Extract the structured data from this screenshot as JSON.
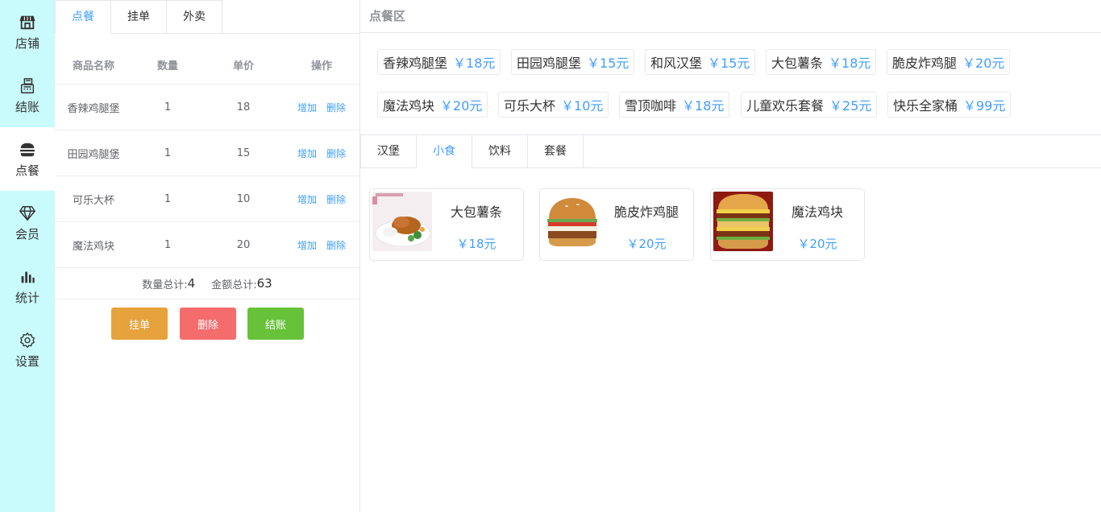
{
  "sidebar": {
    "items": [
      {
        "label": "店铺",
        "icon": "store-icon"
      },
      {
        "label": "结账",
        "icon": "cash-register-icon"
      },
      {
        "label": "点餐",
        "icon": "burger-icon"
      },
      {
        "label": "会员",
        "icon": "diamond-icon"
      },
      {
        "label": "统计",
        "icon": "bar-chart-icon"
      },
      {
        "label": "设置",
        "icon": "gear-icon"
      }
    ],
    "active_index": 2
  },
  "order": {
    "tabs": [
      "点餐",
      "挂单",
      "外卖"
    ],
    "active_tab": 0,
    "columns": [
      "商品名称",
      "数量",
      "单价",
      "操作"
    ],
    "rows": [
      {
        "name": "香辣鸡腿堡",
        "qty": "1",
        "price": "18"
      },
      {
        "name": "田园鸡腿堡",
        "qty": "1",
        "price": "15"
      },
      {
        "name": "可乐大杯",
        "qty": "1",
        "price": "10"
      },
      {
        "name": "魔法鸡块",
        "qty": "1",
        "price": "20"
      }
    ],
    "actions": {
      "add": "增加",
      "remove": "删除"
    },
    "totals": {
      "qty_label": "数量总计:",
      "qty_value": "4",
      "amount_label": "金额总计:",
      "amount_value": "63"
    },
    "buttons": {
      "hang": "挂单",
      "delete": "删除",
      "checkout": "结账"
    }
  },
  "menu": {
    "title": "点餐区",
    "quick_items": [
      {
        "name": "香辣鸡腿堡",
        "price": "￥18元"
      },
      {
        "name": "田园鸡腿堡",
        "price": "￥15元"
      },
      {
        "name": "和风汉堡",
        "price": "￥15元"
      },
      {
        "name": "大包薯条",
        "price": "￥18元"
      },
      {
        "name": "脆皮炸鸡腿",
        "price": "￥20元"
      },
      {
        "name": "魔法鸡块",
        "price": "￥20元"
      },
      {
        "name": "可乐大杯",
        "price": "￥10元"
      },
      {
        "name": "雪顶咖啡",
        "price": "￥18元"
      },
      {
        "name": "儿童欢乐套餐",
        "price": "￥25元"
      },
      {
        "name": "快乐全家桶",
        "price": "￥99元"
      }
    ],
    "category_tabs": [
      "汉堡",
      "小食",
      "饮料",
      "套餐"
    ],
    "active_category": 1,
    "cards": [
      {
        "name": "大包薯条",
        "price": "￥18元"
      },
      {
        "name": "脆皮炸鸡腿",
        "price": "￥20元"
      },
      {
        "name": "魔法鸡块",
        "price": "￥20元"
      }
    ]
  },
  "colors": {
    "sidebar_bg": "#c9fbfd",
    "accent": "#409eff",
    "warning": "#e6a23c",
    "danger": "#f56c6c",
    "success": "#67c23a"
  }
}
